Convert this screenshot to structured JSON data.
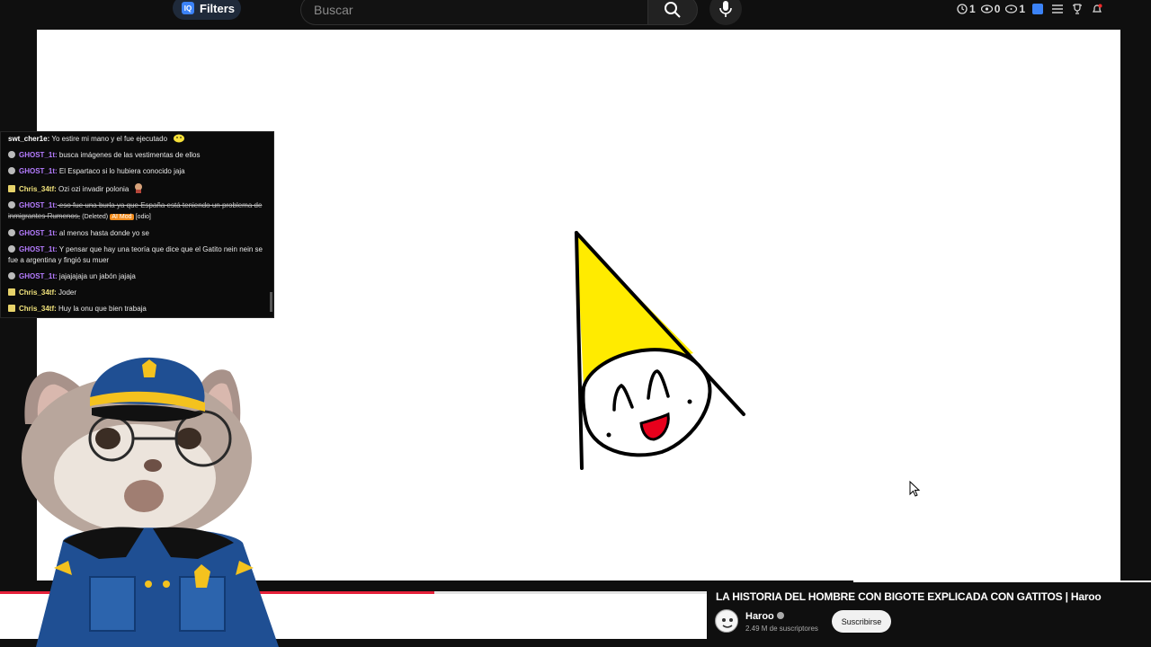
{
  "topbar": {
    "filters_label": "Filters",
    "filters_icon": "IQ",
    "search_placeholder": "Buscar",
    "stats": [
      {
        "icon": "clock-icon",
        "value": "1"
      },
      {
        "icon": "eye-icon",
        "value": "0"
      },
      {
        "icon": "eye-outline-icon",
        "value": "1"
      }
    ]
  },
  "chat": {
    "messages": [
      {
        "badge": "none",
        "user": "swt_cher1e",
        "user_color": "white",
        "text": " Yo estire mi mano y el fue ejecutado"
      },
      {
        "badge": "gray",
        "user": "GHOST_1t",
        "user_color": "purple",
        "text": " busca imágenes de las vestimentas de ellos"
      },
      {
        "badge": "gray",
        "user": "GHOST_1t",
        "user_color": "purple",
        "text": " El Espartaco si lo hubiera conocido jaja"
      },
      {
        "badge": "yellow",
        "user": "Chris_34tf",
        "user_color": "yellow",
        "text": " Ozi ozi invadir polonia"
      },
      {
        "badge": "gray",
        "user": "GHOST_1t",
        "user_color": "purple",
        "text": " eso fue una burla ya que España está teniendo un problema de inmigrantes Rumenos,",
        "deleted": true,
        "tag_deleted": "(Deleted)",
        "tag_ai": "AI Mod",
        "tag_reason": "[odio]"
      },
      {
        "badge": "gray",
        "user": "GHOST_1t",
        "user_color": "purple",
        "text": " al menos hasta donde yo se"
      },
      {
        "badge": "gray",
        "user": "GHOST_1t",
        "user_color": "purple",
        "text": " Y pensar que hay una teoría que dice que el Gatito nein nein se fue a argentina y fingió su muer"
      },
      {
        "badge": "gray",
        "user": "GHOST_1t",
        "user_color": "purple",
        "text": " jajajajaja un jabón jajaja"
      },
      {
        "badge": "yellow",
        "user": "Chris_34tf",
        "user_color": "yellow",
        "text": " Joder"
      },
      {
        "badge": "yellow",
        "user": "Chris_34tf",
        "user_color": "yellow",
        "text": " Huy la onu que bien trabaja"
      }
    ]
  },
  "player": {
    "progress_percent": 61.4
  },
  "video": {
    "title": "LA HISTORIA DEL HOMBRE CON BIGOTE EXPLICADA CON GATITOS | Haroo",
    "channel": "Haroo",
    "subscribers": "2.49 M de suscriptores",
    "subscribe_label": "Suscribirse"
  },
  "colors": {
    "accent_red": "#e5213a",
    "purple_user": "#b57cff",
    "yellow_user": "#f1e27b",
    "hat_yellow": "#ffeb00",
    "mouth_red": "#e8001c"
  }
}
